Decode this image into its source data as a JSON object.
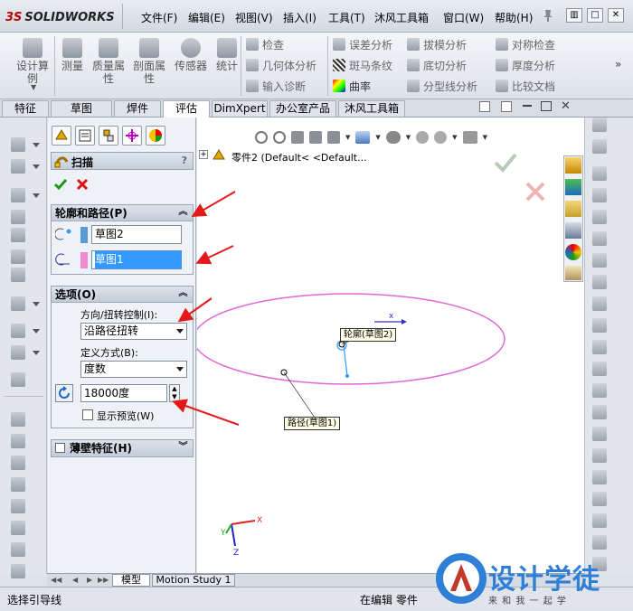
{
  "titlebar": {
    "logo": "SOLIDWORKS",
    "logo_mark": "3S",
    "menus": [
      "文件(F)",
      "编辑(E)",
      "视图(V)",
      "插入(I)",
      "工具(T)",
      "沐风工具箱",
      "窗口(W)",
      "帮助(H)"
    ]
  },
  "ribbon": {
    "big_buttons": [
      "设计算例",
      "测量",
      "质量属性",
      "剖面属性",
      "传感器",
      "统计"
    ],
    "col1": [
      "检查",
      "几何体分析",
      "输入诊断"
    ],
    "col2": [
      "误差分析",
      "斑马条纹",
      "曲率"
    ],
    "col3": [
      "拔模分析",
      "底切分析",
      "分型线分析"
    ],
    "col4": [
      "对称检查",
      "厚度分析",
      "比较文档"
    ]
  },
  "tabs": [
    "特征",
    "草图",
    "焊件",
    "评估",
    "DimXpert",
    "办公室产品",
    "沐风工具箱"
  ],
  "active_tab": "评估",
  "pm": {
    "title": "扫描",
    "help": "?",
    "section_path": "轮廓和路径(P)",
    "profile_value": "草图2",
    "path_value": "草图1",
    "section_options": "选项(O)",
    "orient_label": "方向/扭转控制(I):",
    "orient_value": "沿路径扭转",
    "define_label": "定义方式(B):",
    "define_value": "度数",
    "degrees_value": "18000度",
    "preview_label": "显示预览(W)",
    "section_thin": "薄壁特征(H)"
  },
  "graphics": {
    "tree_label": "零件2  (Default< <Default...",
    "profile_label": "轮廓(草图2)",
    "path_label": "路径(草图1)"
  },
  "bottom_tabs": [
    "模型",
    "Motion Study 1"
  ],
  "status": {
    "left": "选择引导线",
    "mid": "在编辑 零件",
    "brand": "设计学徒",
    "brand_sub": "来 和 我 一 起 学"
  },
  "colors": {
    "ellipse": "#e36ad6",
    "arrow_red": "#e41818",
    "profile_swatch": "#5b9bd5",
    "path_swatch": "#f08bd0",
    "accent_blue": "#3399ff"
  }
}
